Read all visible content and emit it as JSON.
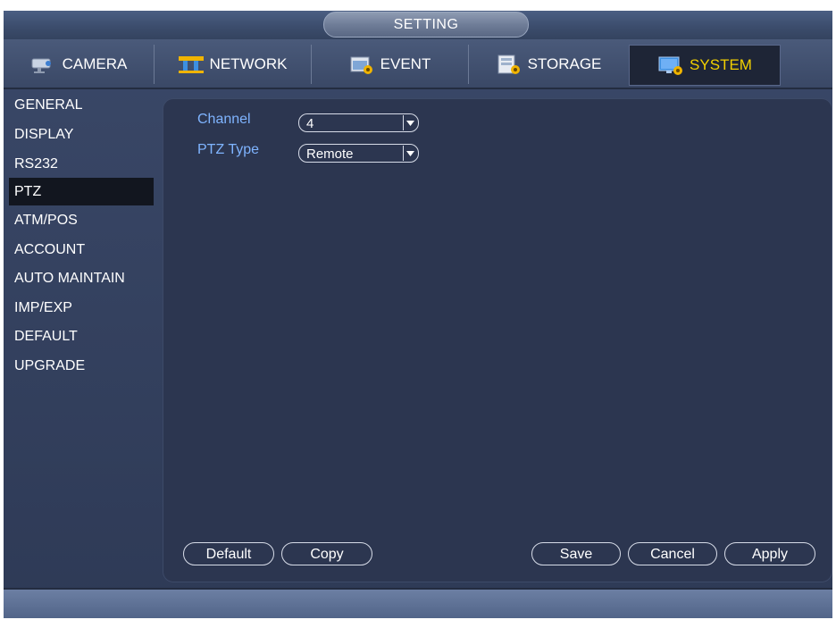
{
  "window": {
    "title": "SETTING"
  },
  "tabs": [
    {
      "label": "CAMERA",
      "icon": "camera-icon"
    },
    {
      "label": "NETWORK",
      "icon": "network-icon"
    },
    {
      "label": "EVENT",
      "icon": "event-icon"
    },
    {
      "label": "STORAGE",
      "icon": "storage-icon"
    },
    {
      "label": "SYSTEM",
      "icon": "system-icon",
      "active": true
    }
  ],
  "sidebar": {
    "items": [
      {
        "label": "GENERAL"
      },
      {
        "label": "DISPLAY"
      },
      {
        "label": "RS232"
      },
      {
        "label": "PTZ",
        "active": true
      },
      {
        "label": "ATM/POS"
      },
      {
        "label": "ACCOUNT"
      },
      {
        "label": "AUTO MAINTAIN"
      },
      {
        "label": "IMP/EXP"
      },
      {
        "label": "DEFAULT"
      },
      {
        "label": "UPGRADE"
      }
    ]
  },
  "form": {
    "channel_label": "Channel",
    "channel_value": "4",
    "ptz_type_label": "PTZ Type",
    "ptz_type_value": "Remote"
  },
  "buttons": {
    "default": "Default",
    "copy": "Copy",
    "save": "Save",
    "cancel": "Cancel",
    "apply": "Apply"
  },
  "colors": {
    "active_tab_text": "#f2d000",
    "field_label": "#7fb4ff",
    "active_sidebar_bg": "#12161f"
  }
}
